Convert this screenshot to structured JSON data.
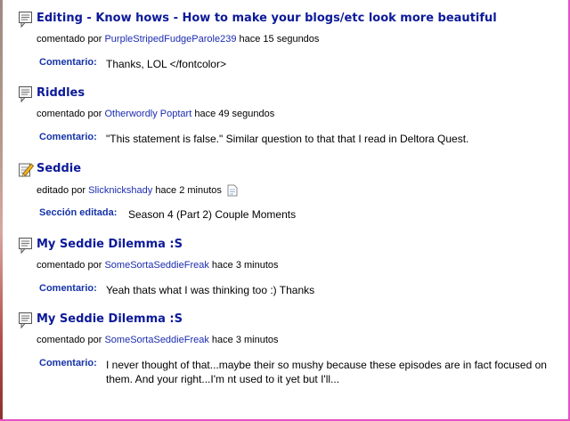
{
  "entries": [
    {
      "icon": "comment-icon",
      "title": "Editing - Know hows - How to make your blogs/etc look more beautiful",
      "action": "comentado por",
      "user": "PurpleStripedFudgeParole239",
      "time": "hace 15 segundos",
      "label": "Comentario:",
      "text": "Thanks, LOL </fontcolor>"
    },
    {
      "icon": "comment-icon",
      "title": "Riddles",
      "action": "comentado por",
      "user": "Otherwordly Poptart",
      "time": "hace 49 segundos",
      "label": "Comentario:",
      "text": "\"This statement is false.\" Similar question to that that I read in Deltora Quest."
    },
    {
      "icon": "edit-pencil-icon",
      "title": "Seddie",
      "action": "editado por",
      "user": "Slicknickshady",
      "time": "hace 2 minutos",
      "label": "Sección editada:",
      "text": "Season 4 (Part 2) Couple Moments"
    },
    {
      "icon": "comment-icon",
      "title": "My Seddie Dilemma :S",
      "action": "comentado por",
      "user": "SomeSortaSeddieFreak",
      "time": "hace 3 minutos",
      "label": "Comentario:",
      "text": "Yeah thats what I was thinking too :) Thanks"
    },
    {
      "icon": "comment-icon",
      "title": "My Seddie Dilemma :S",
      "action": "comentado por",
      "user": "SomeSortaSeddieFreak",
      "time": "hace 3 minutos",
      "label": "Comentario:",
      "text": "I never thought of that...maybe their so mushy because these episodes are in fact focused on them. And your right...I'm nt used to it yet but I'll..."
    }
  ],
  "colors": {
    "title": "#0c1a98",
    "user_link": "#1b2cb0",
    "detail_label": "#1533a8",
    "right_border": "#e64fc4"
  }
}
